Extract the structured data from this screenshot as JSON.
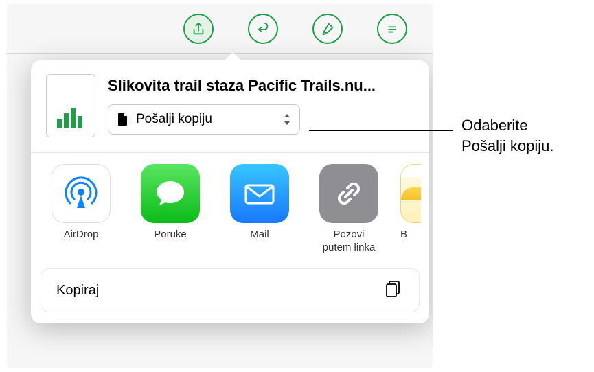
{
  "toolbar": {
    "icons": [
      "share",
      "undo",
      "paint",
      "more"
    ]
  },
  "document": {
    "title": "Slikovita trail staza Pacific Trails.nu..."
  },
  "select": {
    "label": "Pošalji kopiju"
  },
  "share_targets": [
    {
      "label": "AirDrop",
      "icon": "airdrop"
    },
    {
      "label": "Poruke",
      "icon": "messages"
    },
    {
      "label": "Mail",
      "icon": "mail"
    },
    {
      "label": "Pozovi\nputem linka",
      "icon": "invite-link"
    },
    {
      "label": "B",
      "icon": "notes"
    }
  ],
  "actions": {
    "copy": "Kopiraj"
  },
  "callout": {
    "line1": "Odaberite",
    "line2": "Pošalji kopiju."
  }
}
